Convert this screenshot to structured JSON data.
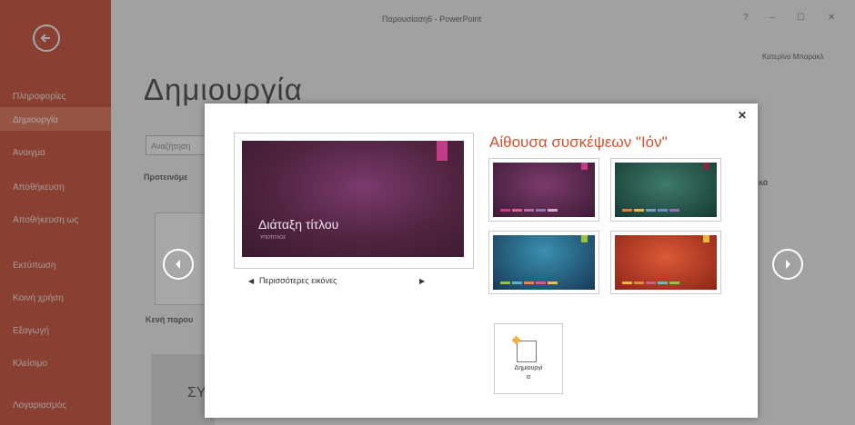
{
  "window": {
    "title": "Παρουσίαση6 - PowerPoint",
    "user": "Κατερίνα Μπαρακλ",
    "help": "?",
    "minimize": "–",
    "maximize": "☐",
    "close": "✕"
  },
  "sidebar": {
    "items": [
      {
        "label": "Πληροφορίες"
      },
      {
        "label": "Δημιουργία",
        "active": true
      },
      {
        "label": "Άνοιγμα"
      },
      {
        "label": "Αποθήκευση"
      },
      {
        "label": "Αποθήκευση ως"
      },
      {
        "label": "Εκτύπωση"
      },
      {
        "label": "Κοινή χρήση"
      },
      {
        "label": "Εξαγωγή"
      },
      {
        "label": "Κλείσιμο"
      },
      {
        "label": "Λογαριασμός"
      }
    ]
  },
  "main": {
    "heading": "Δημιουργία",
    "search_placeholder": "Αναζήτηση",
    "suggested": "Προτεινόμε",
    "blank_label": "Κενή παρου",
    "right_fragment": "κά",
    "thumb_text": "ΣΥ"
  },
  "dialog": {
    "close": "✕",
    "preview_title": "Διάταξη τίτλου",
    "preview_subtitle": "ΥΠΟΤΙΤΛΟΣ",
    "more_images": "Περισσότερες εικόνες",
    "theme_name": "Αίθουσα συσκέψεων \"Ιόν\"",
    "create_label": "Δημιουργί",
    "create_label2": "α",
    "variants": [
      {
        "bg": "radial-gradient(ellipse at 50% 40%, #7b3a6c, #3e1b35)",
        "accent": "#c23d85",
        "dots": [
          "#c23d85",
          "#d3608e",
          "#b56aa8",
          "#8e75b4",
          "#d8a5c6"
        ]
      },
      {
        "bg": "radial-gradient(ellipse at 50% 40%, #3f7a6c, #153a33)",
        "accent": "#7c2c3a",
        "dots": [
          "#e07b3e",
          "#e6b84a",
          "#6ea3b5",
          "#6c8cc2",
          "#9a6fb4"
        ]
      },
      {
        "bg": "radial-gradient(ellipse at 50% 30%, #3a8fb0, #173a56)",
        "accent": "#9bc43a",
        "dots": [
          "#91c33e",
          "#59b4c4",
          "#e58a3d",
          "#d95a88",
          "#e3c24f"
        ]
      },
      {
        "bg": "radial-gradient(ellipse at 50% 40%, #dc5a36, #8c2418)",
        "accent": "#f0b43a",
        "dots": [
          "#f0b43a",
          "#e58a3d",
          "#d45d88",
          "#6fb7c3",
          "#93c53f"
        ]
      }
    ]
  }
}
